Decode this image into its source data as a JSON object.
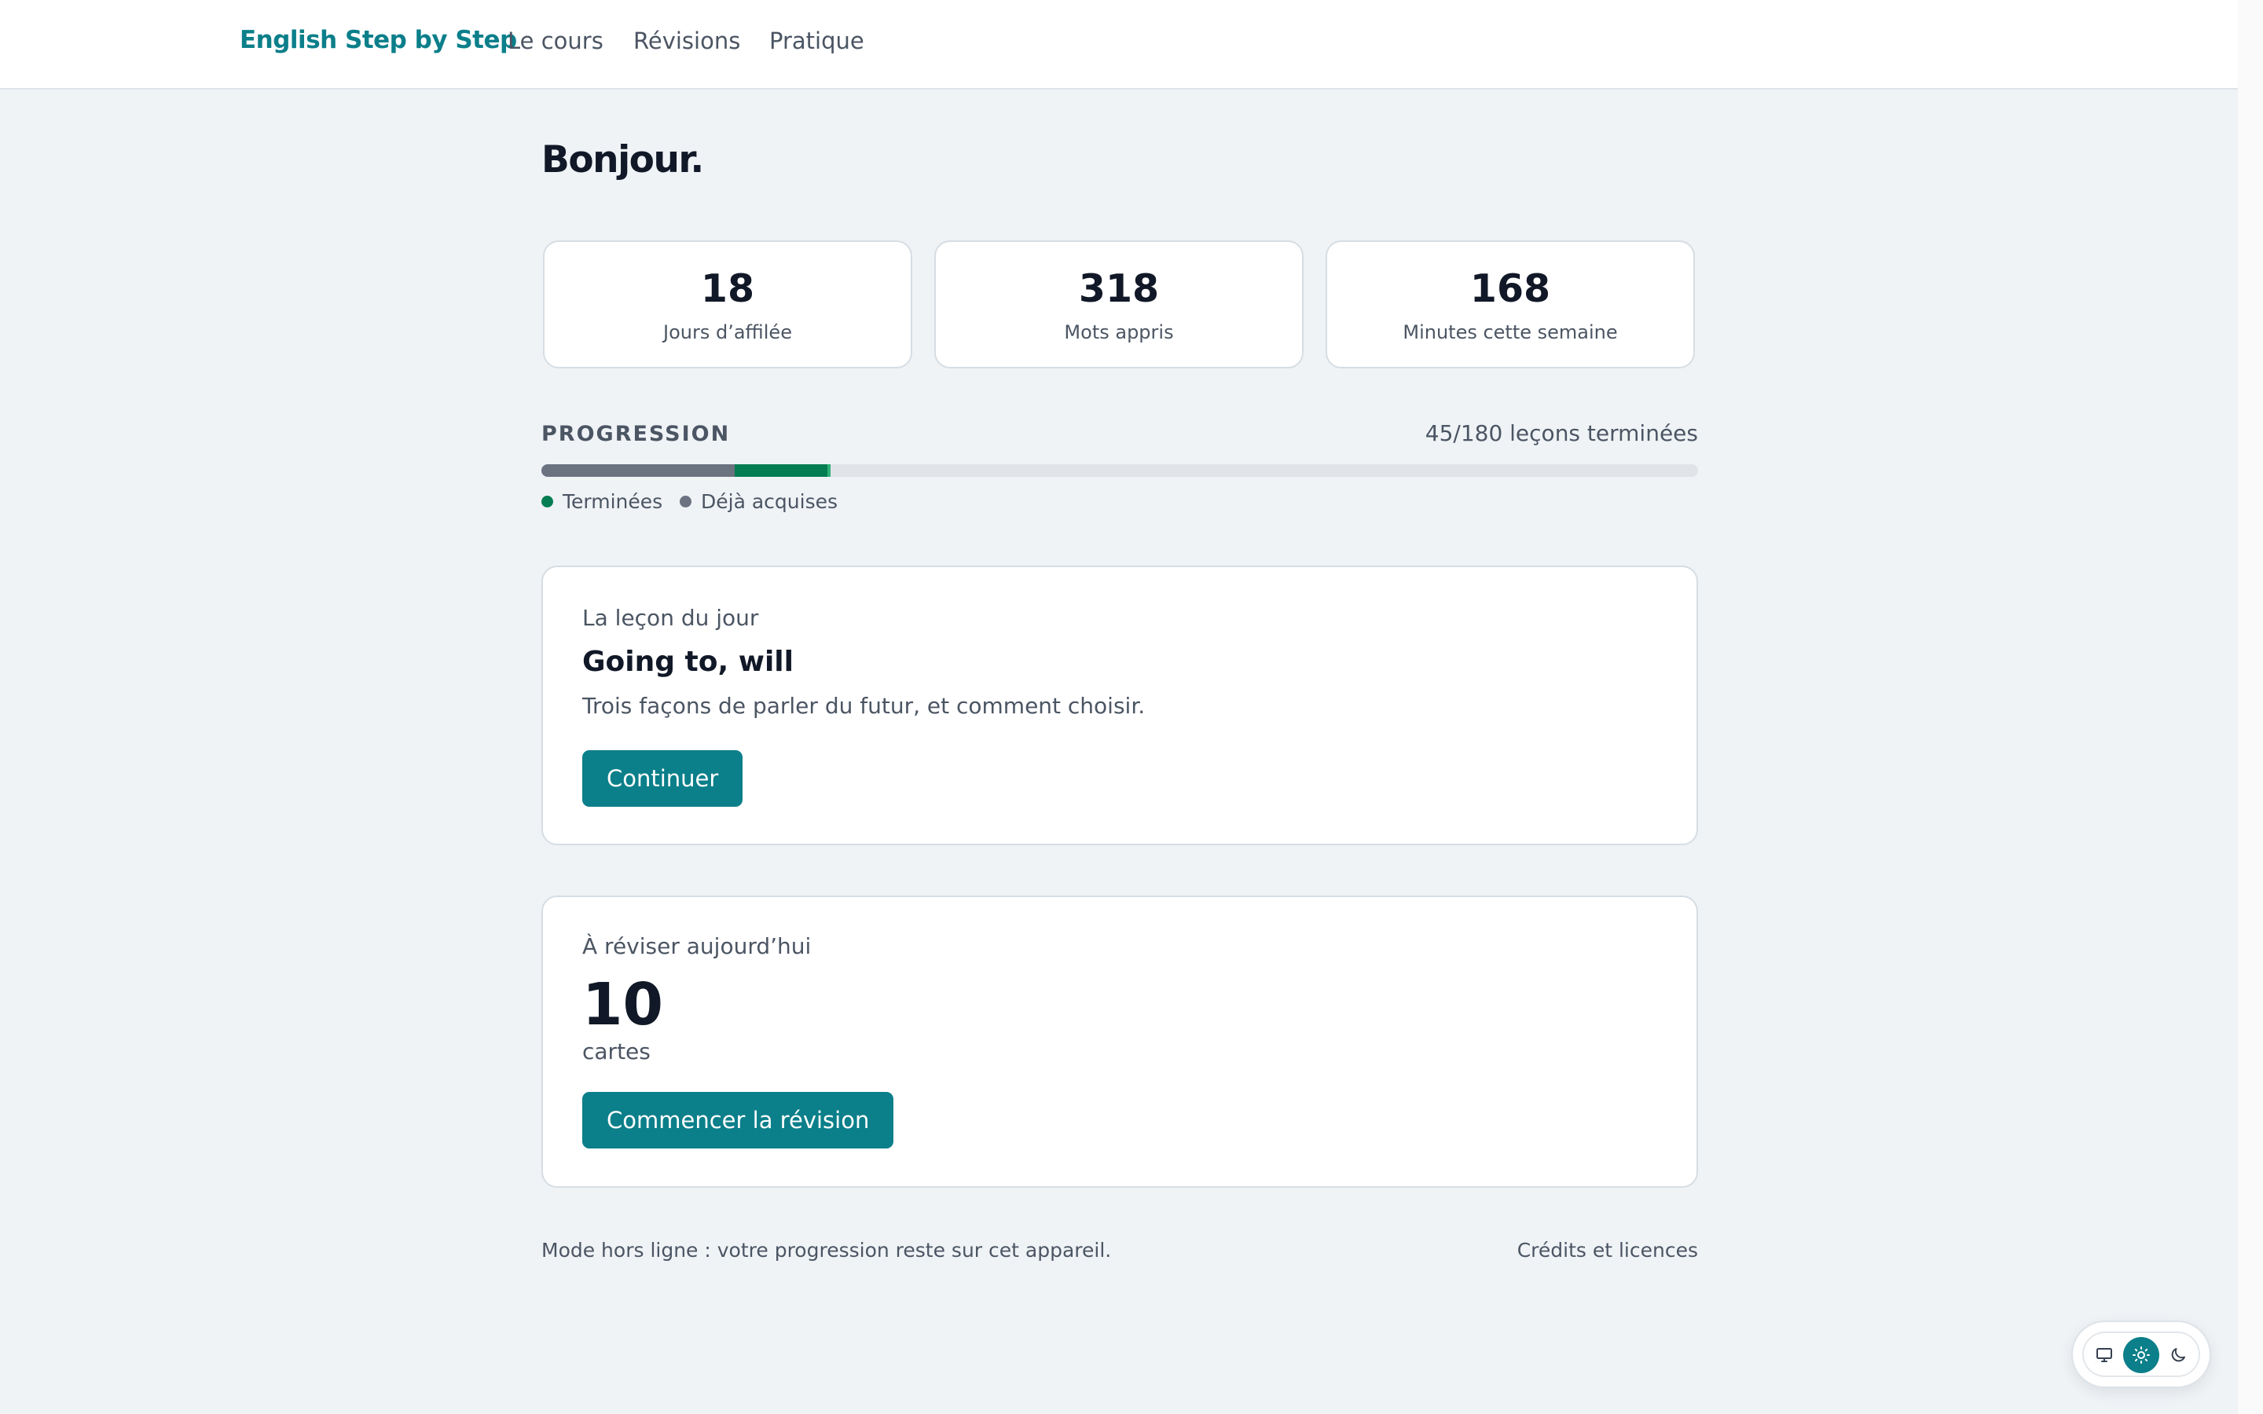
{
  "header": {
    "brand": "English Step by Step",
    "nav": [
      {
        "label": "Le cours"
      },
      {
        "label": "Révisions"
      },
      {
        "label": "Pratique"
      }
    ]
  },
  "greeting": "Bonjour.",
  "stats": [
    {
      "value": "18",
      "label": "Jours d’affilée"
    },
    {
      "value": "318",
      "label": "Mots appris"
    },
    {
      "value": "168",
      "label": "Minutes cette semaine"
    }
  ],
  "progress": {
    "title": "PROGRESSION",
    "count_text": "45/180 leçons terminées",
    "acquired_fraction": 0.167,
    "done_fraction": 0.083,
    "legend": {
      "done": "Terminées",
      "acquired": "Déjà acquises"
    },
    "colors": {
      "done": "#047d52",
      "acquired": "#6b7280",
      "track": "#e0e4e8"
    }
  },
  "lesson": {
    "kicker": "La leçon du jour",
    "title": "Going to, will",
    "description": "Trois façons de parler du futur, et comment choisir.",
    "button": "Continuer"
  },
  "review": {
    "kicker": "À réviser aujourd’hui",
    "count": "10",
    "unit": "cartes",
    "button": "Commencer la révision"
  },
  "footer": {
    "note": "Mode hors ligne : votre progression reste sur cet appareil.",
    "link": "Crédits et licences"
  },
  "theme_switcher": {
    "options": [
      {
        "icon": "monitor-icon",
        "active": false
      },
      {
        "icon": "sun-icon",
        "active": true
      },
      {
        "icon": "moon-icon",
        "active": false
      }
    ]
  },
  "accent_color": "#0b7f8a"
}
